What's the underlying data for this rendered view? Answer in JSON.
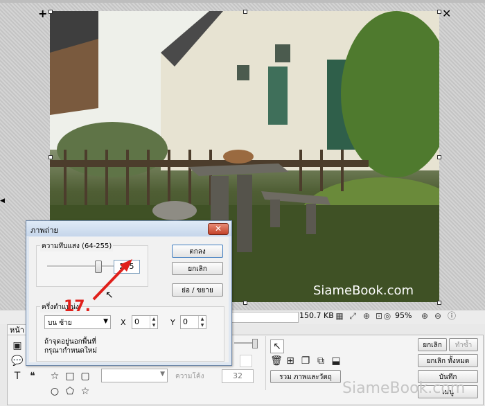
{
  "canvas": {
    "watermark": "SiameBook.com"
  },
  "status_bar": {
    "file_size": "150.7 KB",
    "zoom": "95%"
  },
  "dialog": {
    "title": "ภาพถ่าย",
    "close_label": "✕",
    "opacity_label": "ความทึบแสง (64-255)",
    "opacity_value": "255",
    "opacity_fraction": 1.0,
    "ok_label": "ตกลง",
    "cancel_label": "ยกเลิก",
    "resize_label": "ย่อ / ขยาย",
    "anchor_label": "ครึ่งตำแหน่ง",
    "position_selected": "บน ซ้าย",
    "x_label": "X",
    "x_value": "0",
    "y_label": "Y",
    "y_value": "0",
    "hint_line1": "ถ้าจุดอยู่นอกพื้นที่",
    "hint_line2": "กรุณากำหนดใหม่"
  },
  "annotation": {
    "step": "17."
  },
  "panel": {
    "tab_label": "หน้า",
    "curve_label": "ความโค้ง",
    "curve_value": "32",
    "merge_label": "รวม ภาพและวัตถุ",
    "cancel_label": "ยกเลิก",
    "redo_label": "ทำซ้ำ",
    "cancel_all_label": "ยกเลิก ทั้งหมด",
    "save_label": "บันทึก",
    "menu_label": "เมนู"
  },
  "footer_watermark": "SiameBook.com",
  "icons": {
    "plus": "+",
    "close": "✕",
    "star": "☆",
    "pentagon": "⬠",
    "circle": "○",
    "square": "□",
    "rounded-square": "▢",
    "cursor": "↖",
    "text": "T",
    "quote": "❝"
  },
  "colors": {
    "annotation_red": "#e0201b",
    "dialog_title": "#c6d6ea",
    "close_red": "#c4432a"
  }
}
